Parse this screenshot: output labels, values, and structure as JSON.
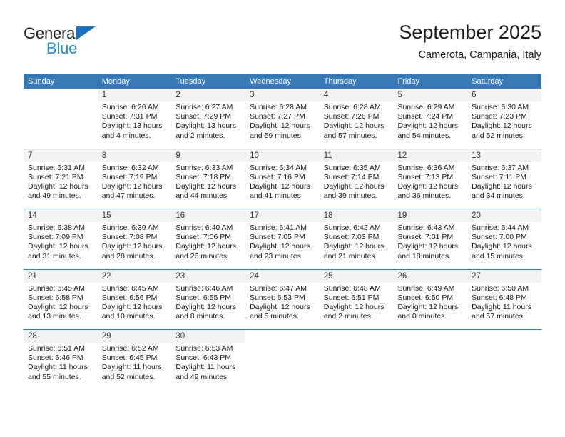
{
  "brand": {
    "name_part1": "General",
    "name_part2": "Blue",
    "accent_color": "#1f8ad6",
    "triangle_color": "#1f72bd"
  },
  "header": {
    "title": "September 2025",
    "subtitle": "Camerota, Campania, Italy"
  },
  "theme": {
    "header_bg": "#3878b4",
    "daynum_bg": "#f2f2f2",
    "cell_bg": "#ffffff",
    "separator": "#3878b4"
  },
  "weekdays": [
    "Sunday",
    "Monday",
    "Tuesday",
    "Wednesday",
    "Thursday",
    "Friday",
    "Saturday"
  ],
  "weeks": [
    {
      "days": [
        {
          "empty": true
        },
        {
          "num": "1",
          "sunrise": "Sunrise: 6:26 AM",
          "sunset": "Sunset: 7:31 PM",
          "daylight1": "Daylight: 13 hours",
          "daylight2": "and 4 minutes."
        },
        {
          "num": "2",
          "sunrise": "Sunrise: 6:27 AM",
          "sunset": "Sunset: 7:29 PM",
          "daylight1": "Daylight: 13 hours",
          "daylight2": "and 2 minutes."
        },
        {
          "num": "3",
          "sunrise": "Sunrise: 6:28 AM",
          "sunset": "Sunset: 7:27 PM",
          "daylight1": "Daylight: 12 hours",
          "daylight2": "and 59 minutes."
        },
        {
          "num": "4",
          "sunrise": "Sunrise: 6:28 AM",
          "sunset": "Sunset: 7:26 PM",
          "daylight1": "Daylight: 12 hours",
          "daylight2": "and 57 minutes."
        },
        {
          "num": "5",
          "sunrise": "Sunrise: 6:29 AM",
          "sunset": "Sunset: 7:24 PM",
          "daylight1": "Daylight: 12 hours",
          "daylight2": "and 54 minutes."
        },
        {
          "num": "6",
          "sunrise": "Sunrise: 6:30 AM",
          "sunset": "Sunset: 7:23 PM",
          "daylight1": "Daylight: 12 hours",
          "daylight2": "and 52 minutes."
        }
      ]
    },
    {
      "days": [
        {
          "num": "7",
          "sunrise": "Sunrise: 6:31 AM",
          "sunset": "Sunset: 7:21 PM",
          "daylight1": "Daylight: 12 hours",
          "daylight2": "and 49 minutes."
        },
        {
          "num": "8",
          "sunrise": "Sunrise: 6:32 AM",
          "sunset": "Sunset: 7:19 PM",
          "daylight1": "Daylight: 12 hours",
          "daylight2": "and 47 minutes."
        },
        {
          "num": "9",
          "sunrise": "Sunrise: 6:33 AM",
          "sunset": "Sunset: 7:18 PM",
          "daylight1": "Daylight: 12 hours",
          "daylight2": "and 44 minutes."
        },
        {
          "num": "10",
          "sunrise": "Sunrise: 6:34 AM",
          "sunset": "Sunset: 7:16 PM",
          "daylight1": "Daylight: 12 hours",
          "daylight2": "and 41 minutes."
        },
        {
          "num": "11",
          "sunrise": "Sunrise: 6:35 AM",
          "sunset": "Sunset: 7:14 PM",
          "daylight1": "Daylight: 12 hours",
          "daylight2": "and 39 minutes."
        },
        {
          "num": "12",
          "sunrise": "Sunrise: 6:36 AM",
          "sunset": "Sunset: 7:13 PM",
          "daylight1": "Daylight: 12 hours",
          "daylight2": "and 36 minutes."
        },
        {
          "num": "13",
          "sunrise": "Sunrise: 6:37 AM",
          "sunset": "Sunset: 7:11 PM",
          "daylight1": "Daylight: 12 hours",
          "daylight2": "and 34 minutes."
        }
      ]
    },
    {
      "days": [
        {
          "num": "14",
          "sunrise": "Sunrise: 6:38 AM",
          "sunset": "Sunset: 7:09 PM",
          "daylight1": "Daylight: 12 hours",
          "daylight2": "and 31 minutes."
        },
        {
          "num": "15",
          "sunrise": "Sunrise: 6:39 AM",
          "sunset": "Sunset: 7:08 PM",
          "daylight1": "Daylight: 12 hours",
          "daylight2": "and 28 minutes."
        },
        {
          "num": "16",
          "sunrise": "Sunrise: 6:40 AM",
          "sunset": "Sunset: 7:06 PM",
          "daylight1": "Daylight: 12 hours",
          "daylight2": "and 26 minutes."
        },
        {
          "num": "17",
          "sunrise": "Sunrise: 6:41 AM",
          "sunset": "Sunset: 7:05 PM",
          "daylight1": "Daylight: 12 hours",
          "daylight2": "and 23 minutes."
        },
        {
          "num": "18",
          "sunrise": "Sunrise: 6:42 AM",
          "sunset": "Sunset: 7:03 PM",
          "daylight1": "Daylight: 12 hours",
          "daylight2": "and 21 minutes."
        },
        {
          "num": "19",
          "sunrise": "Sunrise: 6:43 AM",
          "sunset": "Sunset: 7:01 PM",
          "daylight1": "Daylight: 12 hours",
          "daylight2": "and 18 minutes."
        },
        {
          "num": "20",
          "sunrise": "Sunrise: 6:44 AM",
          "sunset": "Sunset: 7:00 PM",
          "daylight1": "Daylight: 12 hours",
          "daylight2": "and 15 minutes."
        }
      ]
    },
    {
      "days": [
        {
          "num": "21",
          "sunrise": "Sunrise: 6:45 AM",
          "sunset": "Sunset: 6:58 PM",
          "daylight1": "Daylight: 12 hours",
          "daylight2": "and 13 minutes."
        },
        {
          "num": "22",
          "sunrise": "Sunrise: 6:45 AM",
          "sunset": "Sunset: 6:56 PM",
          "daylight1": "Daylight: 12 hours",
          "daylight2": "and 10 minutes."
        },
        {
          "num": "23",
          "sunrise": "Sunrise: 6:46 AM",
          "sunset": "Sunset: 6:55 PM",
          "daylight1": "Daylight: 12 hours",
          "daylight2": "and 8 minutes."
        },
        {
          "num": "24",
          "sunrise": "Sunrise: 6:47 AM",
          "sunset": "Sunset: 6:53 PM",
          "daylight1": "Daylight: 12 hours",
          "daylight2": "and 5 minutes."
        },
        {
          "num": "25",
          "sunrise": "Sunrise: 6:48 AM",
          "sunset": "Sunset: 6:51 PM",
          "daylight1": "Daylight: 12 hours",
          "daylight2": "and 2 minutes."
        },
        {
          "num": "26",
          "sunrise": "Sunrise: 6:49 AM",
          "sunset": "Sunset: 6:50 PM",
          "daylight1": "Daylight: 12 hours",
          "daylight2": "and 0 minutes."
        },
        {
          "num": "27",
          "sunrise": "Sunrise: 6:50 AM",
          "sunset": "Sunset: 6:48 PM",
          "daylight1": "Daylight: 11 hours",
          "daylight2": "and 57 minutes."
        }
      ]
    },
    {
      "days": [
        {
          "num": "28",
          "sunrise": "Sunrise: 6:51 AM",
          "sunset": "Sunset: 6:46 PM",
          "daylight1": "Daylight: 11 hours",
          "daylight2": "and 55 minutes."
        },
        {
          "num": "29",
          "sunrise": "Sunrise: 6:52 AM",
          "sunset": "Sunset: 6:45 PM",
          "daylight1": "Daylight: 11 hours",
          "daylight2": "and 52 minutes."
        },
        {
          "num": "30",
          "sunrise": "Sunrise: 6:53 AM",
          "sunset": "Sunset: 6:43 PM",
          "daylight1": "Daylight: 11 hours",
          "daylight2": "and 49 minutes."
        },
        {
          "empty": true
        },
        {
          "empty": true
        },
        {
          "empty": true
        },
        {
          "empty": true
        }
      ]
    }
  ]
}
